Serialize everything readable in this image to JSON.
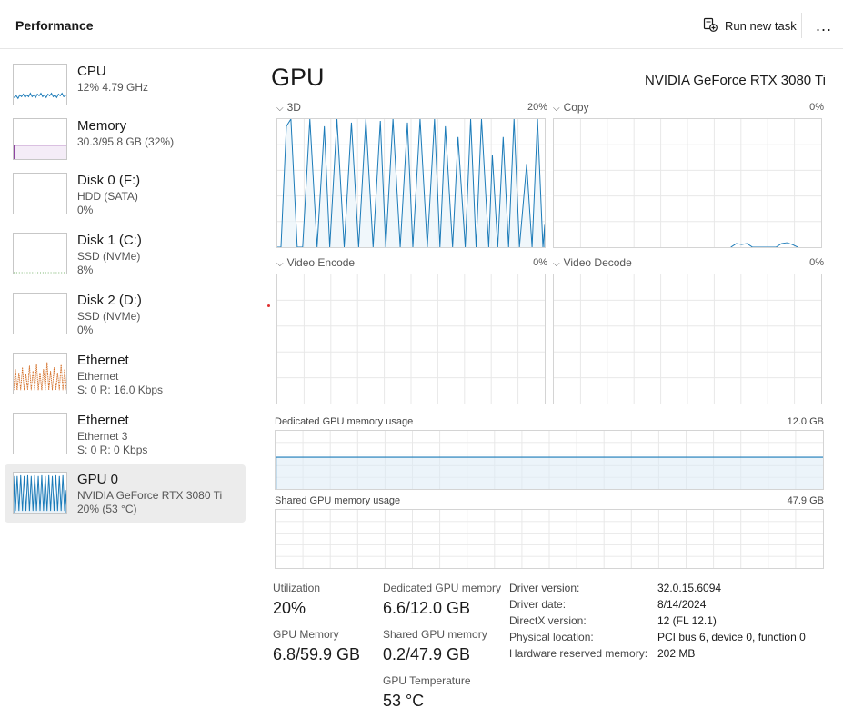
{
  "header": {
    "title": "Performance",
    "run_new_task": "Run new task",
    "more": "..."
  },
  "sidebar": {
    "items": [
      {
        "name": "CPU",
        "line1": "12% 4.79 GHz",
        "line2": ""
      },
      {
        "name": "Memory",
        "line1": "30.3/95.8 GB (32%)",
        "line2": ""
      },
      {
        "name": "Disk 0 (F:)",
        "line1": "HDD (SATA)",
        "line2": "0%"
      },
      {
        "name": "Disk 1 (C:)",
        "line1": "SSD (NVMe)",
        "line2": "8%"
      },
      {
        "name": "Disk 2 (D:)",
        "line1": "SSD (NVMe)",
        "line2": "0%"
      },
      {
        "name": "Ethernet",
        "line1": "Ethernet",
        "line2": "S: 0 R: 16.0 Kbps"
      },
      {
        "name": "Ethernet",
        "line1": "Ethernet 3",
        "line2": "S: 0 R: 0 Kbps"
      },
      {
        "name": "GPU 0",
        "line1": "NVIDIA GeForce RTX 3080 Ti",
        "line2": "20% (53 °C)"
      }
    ]
  },
  "main": {
    "heading": "GPU",
    "model": "NVIDIA GeForce RTX 3080 Ti",
    "engines": [
      {
        "label": "3D",
        "percent": "20%"
      },
      {
        "label": "Copy",
        "percent": "0%"
      },
      {
        "label": "Video Encode",
        "percent": "0%"
      },
      {
        "label": "Video Decode",
        "percent": "0%"
      }
    ],
    "dedicated_memory": {
      "label": "Dedicated GPU memory usage",
      "max": "12.0 GB"
    },
    "shared_memory": {
      "label": "Shared GPU memory usage",
      "max": "47.9 GB"
    },
    "stats": {
      "utilization_label": "Utilization",
      "utilization_value": "20%",
      "gpu_memory_label": "GPU Memory",
      "gpu_memory_value": "6.8/59.9 GB",
      "dedicated_label": "Dedicated GPU memory",
      "dedicated_value": "6.6/12.0 GB",
      "shared_label": "Shared GPU memory",
      "shared_value": "0.2/47.9 GB",
      "temp_label": "GPU Temperature",
      "temp_value": "53 °C"
    },
    "info": [
      {
        "key": "Driver version:",
        "value": "32.0.15.6094"
      },
      {
        "key": "Driver date:",
        "value": "8/14/2024"
      },
      {
        "key": "DirectX version:",
        "value": "12 (FL 12.1)"
      },
      {
        "key": "Physical location:",
        "value": "PCI bus 6, device 0, function 0"
      },
      {
        "key": "Hardware reserved memory:",
        "value": "202 MB"
      }
    ]
  },
  "colors": {
    "gpu_line": "#1a7ab8",
    "gpu_fill": "#eaf3f9",
    "memory_line": "#8b3fa0",
    "ethernet_line": "#d2691e",
    "cpu_line": "#1a7ab8",
    "grid": "#e4e4e4"
  }
}
